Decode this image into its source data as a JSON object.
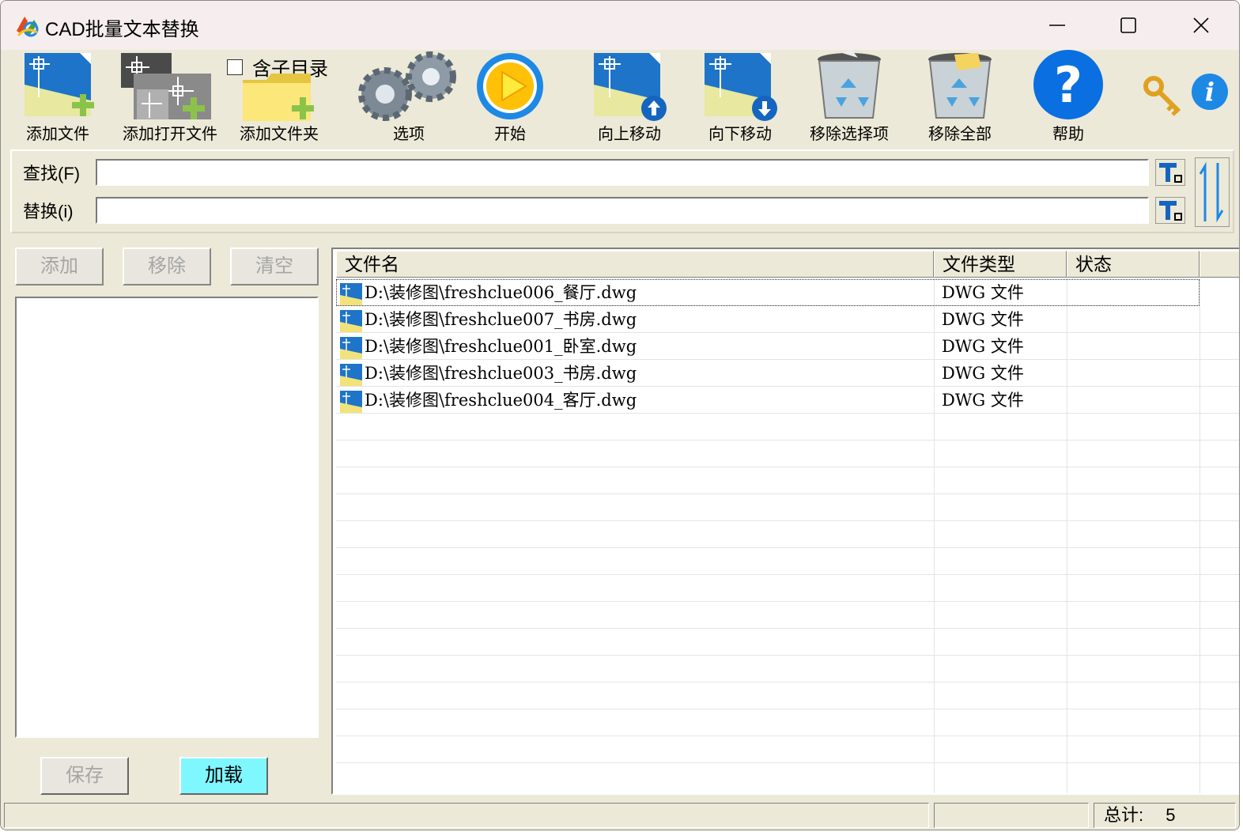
{
  "window": {
    "title": "CAD批量文本替换"
  },
  "toolbar": {
    "add_file": "添加文件",
    "add_open_file": "添加打开文件",
    "add_folder": "添加文件夹",
    "include_subdir": "含子目录",
    "options": "选项",
    "start": "开始",
    "move_up": "向上移动",
    "move_down": "向下移动",
    "remove_selected": "移除选择项",
    "remove_all": "移除全部",
    "help": "帮助"
  },
  "search": {
    "find_label": "查找(F)",
    "find_value": "",
    "replace_label": "替换(i)",
    "replace_value": ""
  },
  "left_panel": {
    "add_label": "添加",
    "remove_label": "移除",
    "clear_label": "清空",
    "save_label": "保存",
    "load_label": "加载"
  },
  "file_list": {
    "columns": [
      "文件名",
      "文件类型",
      "状态"
    ],
    "rows": [
      {
        "name": "D:\\装修图\\freshclue006_餐厅.dwg",
        "type": "DWG 文件",
        "status": ""
      },
      {
        "name": "D:\\装修图\\freshclue007_书房.dwg",
        "type": "DWG 文件",
        "status": ""
      },
      {
        "name": "D:\\装修图\\freshclue001_卧室.dwg",
        "type": "DWG 文件",
        "status": ""
      },
      {
        "name": "D:\\装修图\\freshclue003_书房.dwg",
        "type": "DWG 文件",
        "status": ""
      },
      {
        "name": "D:\\装修图\\freshclue004_客厅.dwg",
        "type": "DWG 文件",
        "status": ""
      }
    ]
  },
  "status_bar": {
    "total_label": "总计:",
    "total_value": "5"
  },
  "colors": {
    "window_bg": "#ece9d8",
    "titlebar_bg": "#f6eeee",
    "load_button_bg": "#7ff7ff",
    "help_blue": "#0a6fe0"
  }
}
